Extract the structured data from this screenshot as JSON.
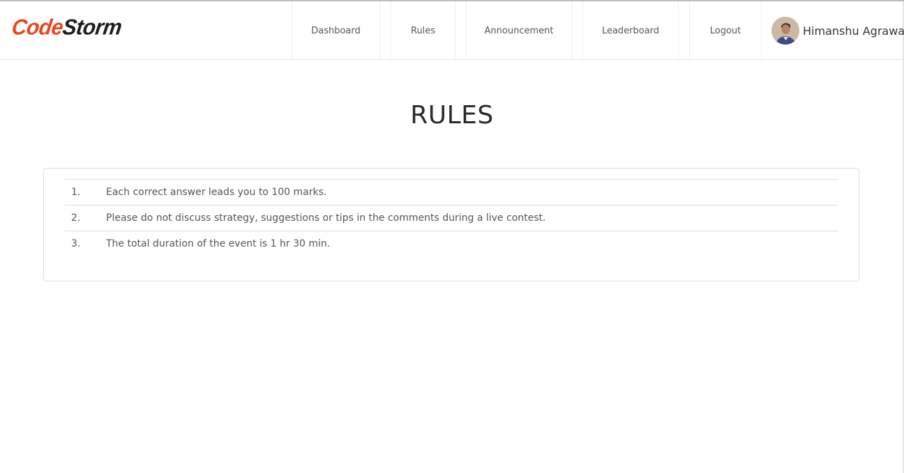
{
  "brand": {
    "part1": "Code",
    "part2": "Storm"
  },
  "nav": {
    "items": [
      {
        "label": "Dashboard"
      },
      {
        "label": "Rules"
      },
      {
        "label": "Announcement"
      },
      {
        "label": "Leaderboard"
      },
      {
        "label": "Logout"
      }
    ]
  },
  "user": {
    "name": "Himanshu Agrawal"
  },
  "page": {
    "title": "RULES"
  },
  "rules": [
    {
      "num": "1.",
      "text": "Each correct answer leads you to 100 marks."
    },
    {
      "num": "2.",
      "text": "Please do not discuss strategy, suggestions or tips in the comments during a live contest."
    },
    {
      "num": "3.",
      "text": "The total duration of the event is 1 hr 30 min."
    }
  ],
  "colors": {
    "brand_accent": "#e8471f",
    "brand_dark": "#1d1d1d"
  }
}
